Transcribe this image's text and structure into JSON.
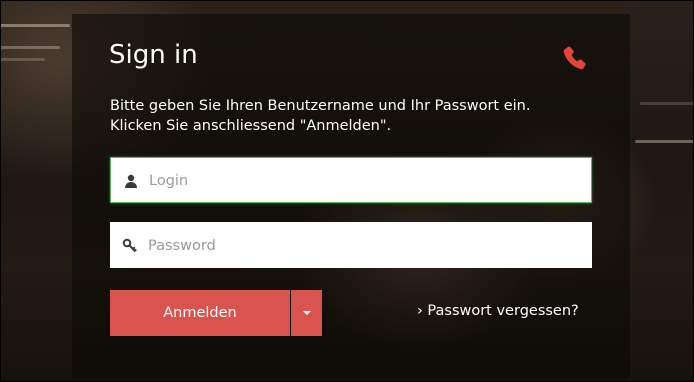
{
  "login_box": {
    "title": "Sign in",
    "intro_line1": "Bitte geben Sie Ihren Benutzername und Ihr Passwort ein.",
    "intro_line2": "Klicken Sie anschliessend \"Anmelden\".",
    "login_placeholder": "Login",
    "password_placeholder": "Password",
    "submit_label": "Anmelden",
    "forgot_label": "› Passwort vergessen?"
  },
  "icons": {
    "phone": "phone-icon",
    "user": "user-icon",
    "key": "key-icon",
    "caret": "caret-down-icon"
  },
  "colors": {
    "accent": "#d9534f",
    "focus_border": "#5cb85c",
    "text": "#ffffff"
  }
}
